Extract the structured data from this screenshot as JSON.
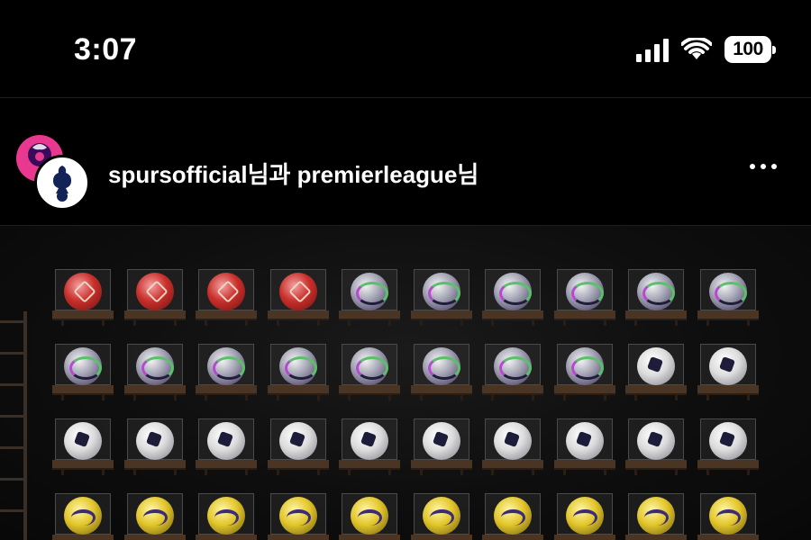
{
  "status_bar": {
    "time": "3:07",
    "battery": "100",
    "icons": [
      "cellular-signal-icon",
      "wifi-icon",
      "battery-icon"
    ]
  },
  "post": {
    "users_text": "spursofficial님과 premierleague님",
    "avatars": [
      "premier-league-logo",
      "spurs-cockerel-logo"
    ],
    "more_icon": "more-horizontal-icon"
  },
  "image": {
    "description_icons": "football-display-cases",
    "rows": [
      [
        "red",
        "red",
        "red",
        "red",
        "purple",
        "purple",
        "purple",
        "purple",
        "purple",
        "purple"
      ],
      [
        "purple",
        "purple",
        "purple",
        "purple",
        "purple",
        "purple",
        "purple",
        "purple",
        "white",
        "white"
      ],
      [
        "white",
        "white",
        "white",
        "white",
        "white",
        "white",
        "white",
        "white",
        "white",
        "white"
      ],
      [
        "yellow",
        "yellow",
        "yellow",
        "yellow",
        "yellow",
        "yellow",
        "yellow",
        "yellow",
        "yellow",
        "yellow"
      ]
    ]
  },
  "colors": {
    "background": "#000000",
    "pl_pink": "#e8388f"
  }
}
